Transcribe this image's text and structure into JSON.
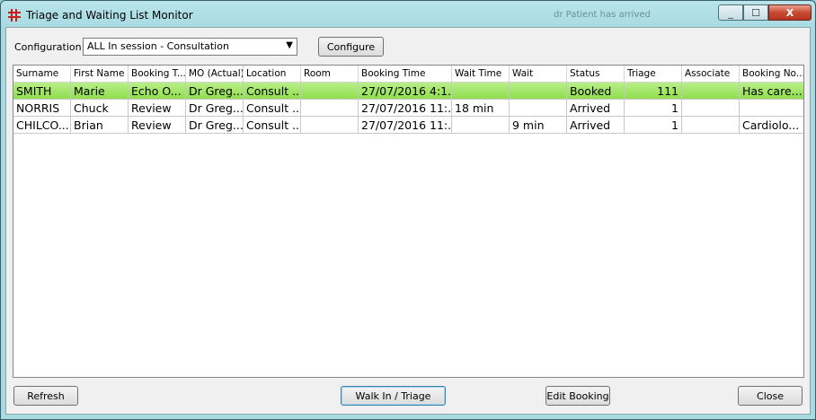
{
  "window": {
    "title": "Triage and Waiting List Monitor",
    "ghost_text": "dr Patient has arrived",
    "min_glyph": "_",
    "max_glyph": "☐",
    "close_glyph": "X"
  },
  "config": {
    "label": "Configuration:",
    "value": "ALL In session - Consultation",
    "arrow": "▼",
    "configure_label": "Configure"
  },
  "table": {
    "columns": [
      "Surname",
      "First Name",
      "Booking T...",
      "MO (Actual)",
      "Location",
      "Room",
      "Booking Time",
      "Wait Time",
      "Wait",
      "Status",
      "Triage",
      "Associate",
      "Booking No..."
    ],
    "rows": [
      [
        "SMITH",
        "Marie",
        "Echo O...",
        "Dr Greg...",
        "Consult ...",
        "",
        "27/07/2016 4:1...",
        "",
        "",
        "Booked",
        "111",
        "",
        "Has care..."
      ],
      [
        "NORRIS",
        "Chuck",
        "Review",
        "Dr Greg...",
        "Consult ...",
        "",
        "27/07/2016 11:...",
        "18 min",
        "",
        "Arrived",
        "1",
        "",
        ""
      ],
      [
        "CHILCO...",
        "Brian",
        "Review",
        "Dr Greg...",
        "Consult ...",
        "",
        "27/07/2016 11:...",
        "",
        "9 min",
        "Arrived",
        "1",
        "",
        "Cardiolo..."
      ]
    ]
  },
  "buttons": {
    "refresh": "Refresh",
    "walkin": "Walk In / Triage",
    "edit": "Edit Booking",
    "close": "Close"
  },
  "colors": {
    "selected_row": "#9ee45e",
    "title_bar": "#a6dbe3",
    "close_button": "#c84a32"
  }
}
